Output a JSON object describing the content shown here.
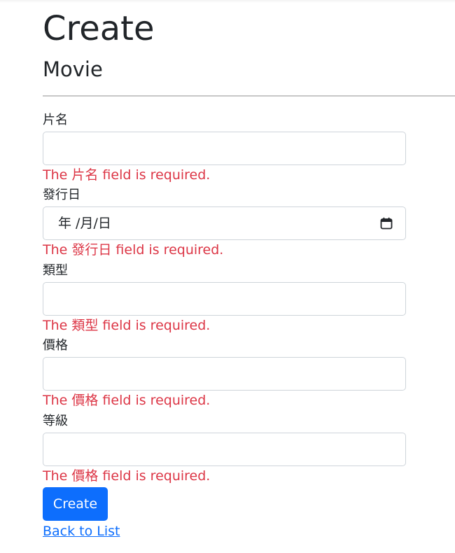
{
  "page": {
    "title": "Create",
    "subtitle": "Movie"
  },
  "form": {
    "fields": [
      {
        "label": "片名",
        "value": "",
        "error": "The 片名 field is required."
      },
      {
        "label": "發行日",
        "value": "年 /月/日",
        "error": "The 發行日 field is required."
      },
      {
        "label": "類型",
        "value": "",
        "error": "The 類型 field is required."
      },
      {
        "label": "價格",
        "value": "",
        "error": "The 價格 field is required."
      },
      {
        "label": "等級",
        "value": "",
        "error": "The 價格 field is required."
      }
    ],
    "submit_label": "Create",
    "back_link": "Back to List"
  },
  "icons": {
    "date_picker": "calendar-icon"
  },
  "colors": {
    "primary": "#0d6efd",
    "error": "#dc3545",
    "text": "#212529",
    "input_border": "#ced4da"
  }
}
